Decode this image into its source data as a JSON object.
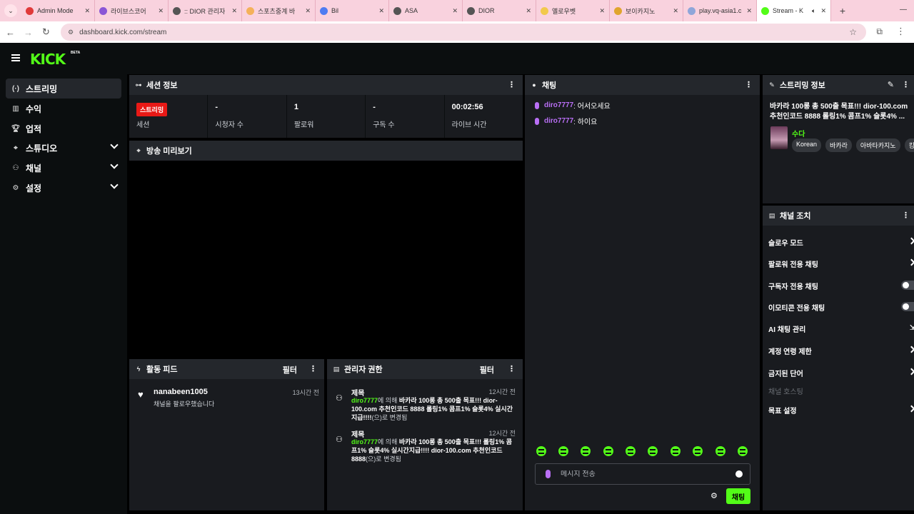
{
  "browser": {
    "tabs": [
      {
        "label": "Admin Mode",
        "favicon_color": "#e03a3a"
      },
      {
        "label": "라이브스코어",
        "favicon_color": "#8a56d6"
      },
      {
        "label": ":: DIOR 관리자",
        "favicon_color": "#555555"
      },
      {
        "label": "스포츠중계 바",
        "favicon_color": "#f4b15a"
      },
      {
        "label": "Bil",
        "favicon_color": "#4f7cf2"
      },
      {
        "label": "ASA",
        "favicon_color": "#555555"
      },
      {
        "label": "DIOR",
        "favicon_color": "#555555"
      },
      {
        "label": "옐로우벳",
        "favicon_color": "#f2c94c"
      },
      {
        "label": "보이카지노",
        "favicon_color": "#e0a52d"
      },
      {
        "label": "play.vq-asia1.c",
        "favicon_color": "#8fa6d9"
      },
      {
        "label": "Stream - K",
        "favicon_color": "#53fc18",
        "active": true
      }
    ],
    "url": "dashboard.kick.com/stream"
  },
  "header": {
    "logo": "KICK",
    "logo_badge": "BETA"
  },
  "sidebar": {
    "items": [
      {
        "label": "스트리밍",
        "icon": "broadcast-icon",
        "active": true
      },
      {
        "label": "수익",
        "icon": "revenue-icon"
      },
      {
        "label": "업적",
        "icon": "trophy-icon"
      },
      {
        "label": "스튜디오",
        "icon": "studio-icon",
        "expandable": true
      },
      {
        "label": "채널",
        "icon": "channel-icon",
        "expandable": true
      },
      {
        "label": "설정",
        "icon": "gear-icon",
        "expandable": true
      }
    ]
  },
  "session": {
    "title": "세션 정보",
    "stats": [
      {
        "value": "스트리밍",
        "label": "세션",
        "badge": true
      },
      {
        "value": "-",
        "label": "시청자 수"
      },
      {
        "value": "1",
        "label": "팔로워"
      },
      {
        "value": "-",
        "label": "구독 수"
      },
      {
        "value": "00:02:56",
        "label": "라이브 시간"
      }
    ]
  },
  "preview": {
    "title": "방송 미리보기"
  },
  "chat": {
    "title": "채팅",
    "messages": [
      {
        "user": "diro7777",
        "text": ": 어서오세요"
      },
      {
        "user": "diro7777",
        "text": ": 하이요"
      }
    ],
    "emote_count": 10,
    "input_placeholder": "메시지 전송",
    "send_label": "채팅"
  },
  "activity": {
    "title": "활동 피드",
    "filter_label": "필터",
    "items": [
      {
        "name": "nanabeen1005",
        "desc": "채널을 팔로우했습니다",
        "time": "13시간 전"
      }
    ]
  },
  "modlog": {
    "title": "관리자 권한",
    "filter_label": "필터",
    "items": [
      {
        "heading": "제목",
        "time": "12시간 전",
        "user": "diro7777",
        "mid": "에 의해 ",
        "title_text": "바카라 100롱 총 500출 목표!!! dior-100.com 추천인코드 8888 롤링1% 콤프1% 슬롯4% 실시간지급!!!!",
        "suffix": "(으)로 변경됨"
      },
      {
        "heading": "제목",
        "time": "12시간 전",
        "user": "diro7777",
        "mid": "에 의해 ",
        "title_text": "바카라 100롱 총 500출 목표!!! 롤링1% 콤프1% 슬롯4% 실시간지급!!!! dior-100.com 추천인코드 8888",
        "suffix": "(으)로 변경됨"
      }
    ]
  },
  "stream_info": {
    "title": "스트리밍 정보",
    "stream_title": "바카라 100롱 총 500출 목표!!! dior-100.com 추천인코드 8888 롤링1% 콤프1% 슬롯4% ...",
    "category": "수다",
    "tags": [
      "Korean",
      "바카라",
      "아바타카지노",
      "킹브"
    ]
  },
  "channel_actions": {
    "title": "채널 조치",
    "items": [
      {
        "label": "슬로우 모드",
        "control": "chevron"
      },
      {
        "label": "팔로워 전용 채팅",
        "control": "chevron"
      },
      {
        "label": "구독자 전용 채팅",
        "control": "toggle"
      },
      {
        "label": "이모티콘 전용 채팅",
        "control": "toggle"
      },
      {
        "label": "AI 채팅 관리",
        "control": "external"
      },
      {
        "label": "계정 연령 제한",
        "control": "chevron"
      },
      {
        "label": "금지된 단어",
        "control": "chevron"
      },
      {
        "label": "채널 호스팅",
        "control": "none",
        "disabled": true
      },
      {
        "label": "목표 설정",
        "control": "chevron"
      }
    ]
  }
}
